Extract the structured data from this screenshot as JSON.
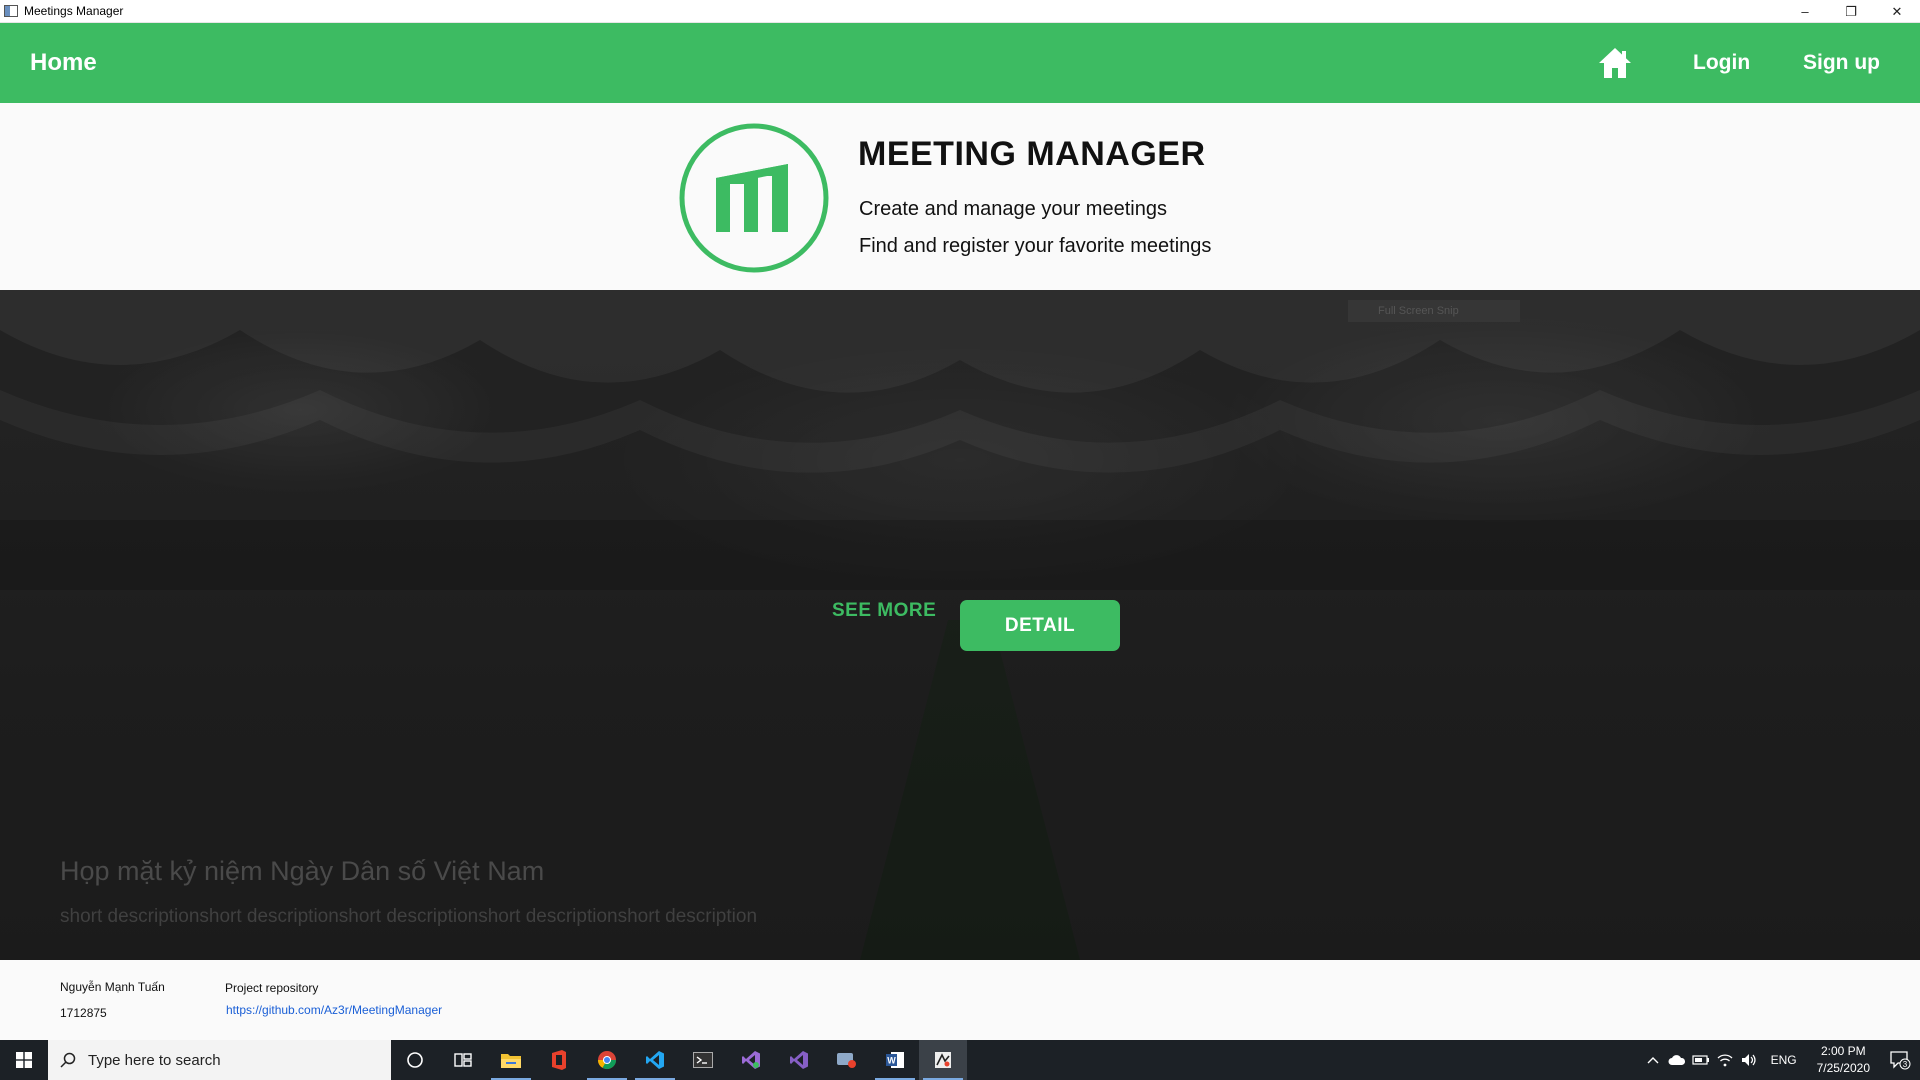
{
  "window": {
    "title": "Meetings Manager",
    "controls": {
      "minimize": "–",
      "restore": "❐",
      "close": "✕"
    }
  },
  "nav": {
    "home_label": "Home",
    "home_icon": "home-icon",
    "login_label": "Login",
    "signup_label": "Sign up"
  },
  "header": {
    "title": "MEETING MANAGER",
    "line1": "Create and manage your meetings",
    "line2": "Find and register your favorite meetings"
  },
  "hero": {
    "snip_overlay": "Full Screen Snip",
    "see_more_label": "SEE MORE",
    "detail_label": "DETAIL",
    "meeting_title": "Họp mặt kỷ niệm Ngày Dân số Việt Nam",
    "meeting_description": "short descriptionshort descriptionshort descriptionshort descriptionshort description"
  },
  "footer": {
    "author": "Nguyễn Mạnh Tuấn",
    "student_id": "1712875",
    "repo_label": "Project repository",
    "repo_url": "https://github.com/Az3r/MeetingManager"
  },
  "taskbar": {
    "search_placeholder": "Type here to search",
    "apps": [
      "cortana-icon",
      "task-view-icon",
      "file-explorer-icon",
      "office-icon",
      "chrome-icon",
      "vscode-icon",
      "terminal-icon",
      "visual-studio-preview-icon",
      "visual-studio-icon",
      "snipping-icon",
      "word-icon",
      "meetings-manager-icon"
    ],
    "language": "ENG",
    "time": "2:00 PM",
    "date": "7/25/2020",
    "notification_count": "3"
  },
  "colors": {
    "accent": "#3dbb62",
    "taskbar": "#1c2126",
    "link": "#1a5fd6"
  }
}
